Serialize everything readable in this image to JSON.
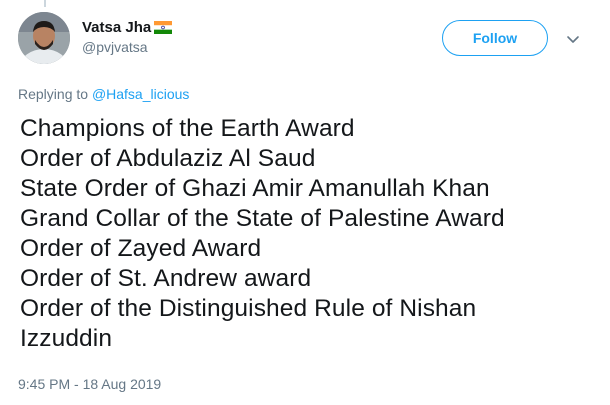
{
  "author": {
    "display_name": "Vatsa Jha",
    "handle": "@pvjvatsa",
    "flag_icon": "india-flag-icon"
  },
  "actions": {
    "follow_label": "Follow",
    "more_icon": "chevron-down-icon"
  },
  "reply": {
    "prefix": "Replying to",
    "to_handle": "@Hafsa_licious"
  },
  "tweet": {
    "lines": [
      "Champions of the Earth Award",
      "Order of Abdulaziz Al Saud",
      "State Order of Ghazi Amir Amanullah Khan",
      "Grand Collar of the State of Palestine Award",
      "Order of Zayed Award",
      "Order of St. Andrew award",
      "Order of the Distinguished Rule of Nishan",
      "Izzuddin"
    ],
    "timestamp": "9:45 PM - 18 Aug 2019"
  },
  "colors": {
    "accent": "#1da1f2",
    "text": "#14171a",
    "muted": "#657786",
    "flag_saffron": "#ff9933",
    "flag_white": "#ffffff",
    "flag_green": "#138808",
    "flag_chakra": "#000080"
  }
}
